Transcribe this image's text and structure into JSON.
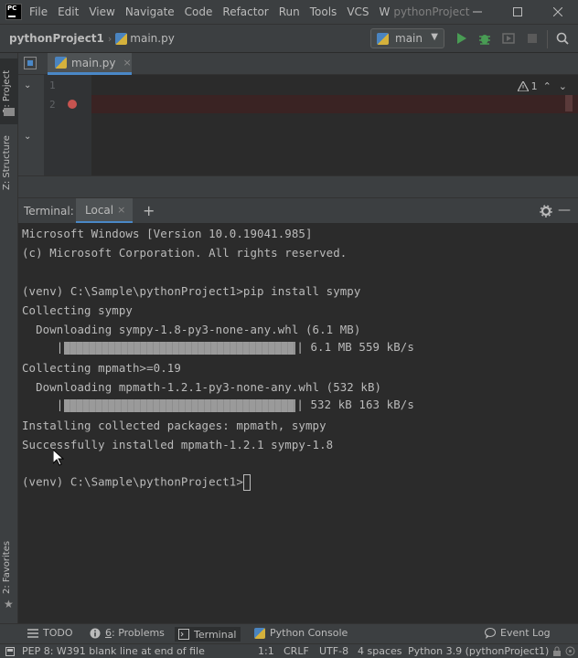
{
  "menubar": {
    "logo_text": "PC",
    "items": [
      "File",
      "Edit",
      "View",
      "Navigate",
      "Code",
      "Refactor",
      "Run",
      "Tools",
      "VCS",
      "W"
    ],
    "window_title": "pythonProject",
    "minimize_icon": "minimize-icon",
    "maximize_icon": "maximize-icon",
    "close_icon": "close-icon"
  },
  "navbar": {
    "project": "pythonProject1",
    "file": "main.py",
    "run_config": "main"
  },
  "left_strip": {
    "project_tab": "1: Project",
    "structure_tab": "Z: Structure",
    "favorites_tab": "2: Favorites"
  },
  "editor": {
    "tab_label": "main.py",
    "line_numbers": [
      "1",
      "2"
    ],
    "inspection_count": "1"
  },
  "terminal": {
    "title": "Terminal:",
    "tab_label": "Local",
    "lines": [
      "Microsoft Windows [Version 10.0.19041.985]",
      "(c) Microsoft Corporation. All rights reserved.",
      "",
      "(venv) C:\\Sample\\pythonProject1>pip install sympy",
      "Collecting sympy",
      "  Downloading sympy-1.8-py3-none-any.whl (6.1 MB)",
      "",
      "Collecting mpmath>=0.19",
      "  Downloading mpmath-1.2.1-py3-none-any.whl (532 kB)",
      "",
      "Installing collected packages: mpmath, sympy",
      "Successfully installed mpmath-1.2.1 sympy-1.8",
      "",
      "(venv) C:\\Sample\\pythonProject1>"
    ],
    "progress": [
      {
        "suffix": "| 6.1 MB 559 kB/s",
        "fraction": 1.0
      },
      {
        "suffix": "| 532 kB 163 kB/s",
        "fraction": 1.0
      }
    ],
    "progress_prefix": "     |"
  },
  "bottom_bar": {
    "todo": "TODO",
    "problems_prefix": "6",
    "problems": ": Problems",
    "terminal": "Terminal",
    "python_console": "Python Console",
    "event_log": "Event Log"
  },
  "status_bar": {
    "message": "PEP 8: W391 blank line at end of file",
    "position": "1:1",
    "line_sep": "CRLF",
    "encoding": "UTF-8",
    "indent": "4 spaces",
    "interpreter": "Python 3.9 (pythonProject1)"
  },
  "colors": {
    "accent": "#4a88c7",
    "breakpoint": "#c75450",
    "run_green": "#499c54"
  }
}
